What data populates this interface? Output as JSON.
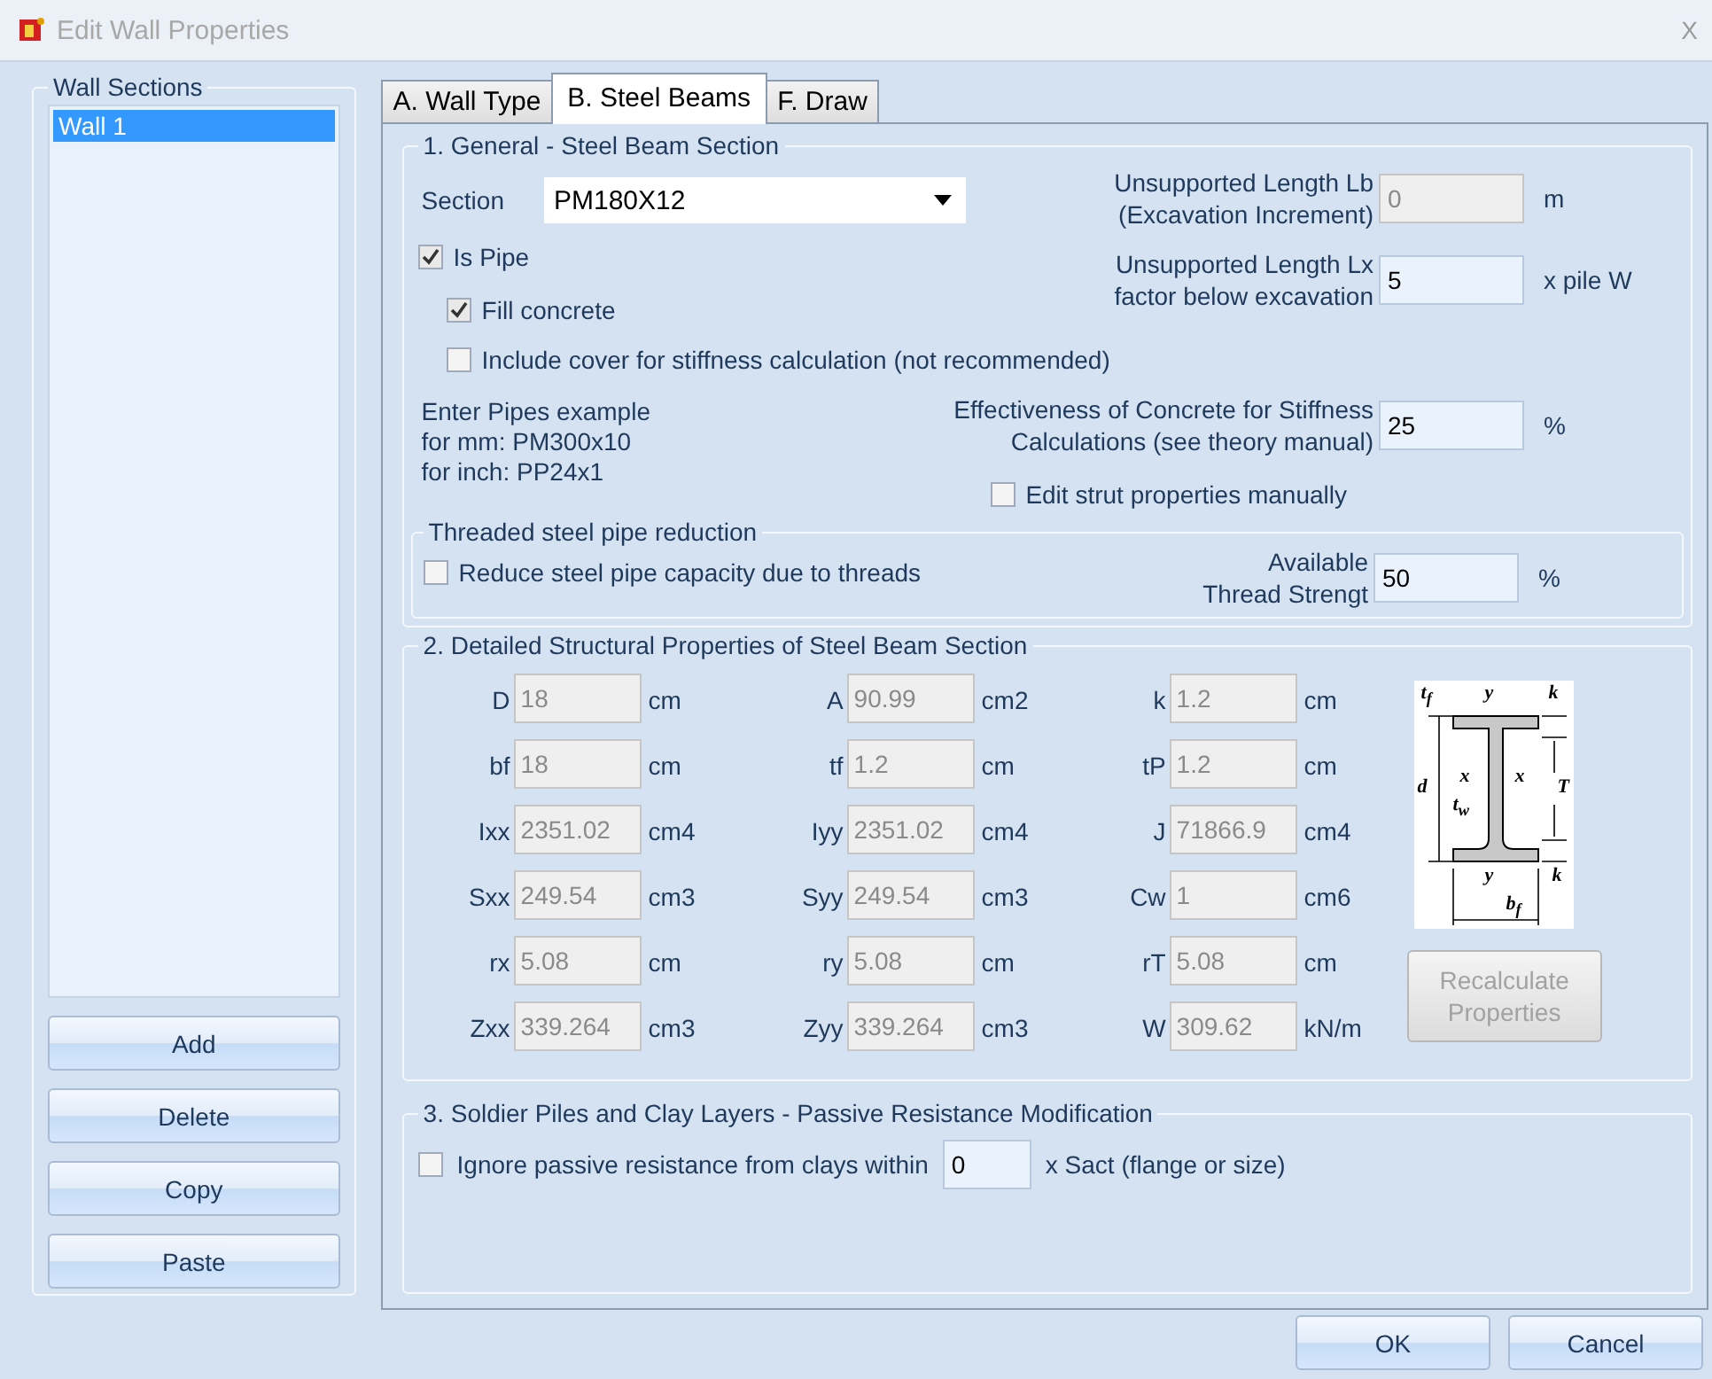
{
  "window": {
    "title": "Edit Wall Properties",
    "close": "X"
  },
  "wall_sections": {
    "title": "Wall Sections",
    "items": [
      {
        "label": "Wall 1",
        "selected": true
      }
    ],
    "buttons": [
      "Add",
      "Delete",
      "Copy",
      "Paste"
    ]
  },
  "tabs": [
    {
      "label": "A. Wall Type",
      "selected": false
    },
    {
      "label": "B. Steel Beams",
      "selected": true
    },
    {
      "label": "F. Draw",
      "selected": false
    }
  ],
  "general": {
    "title": "1. General - Steel Beam Section",
    "section_label": "Section",
    "section_value": "PM180X12",
    "checks": [
      {
        "label": "Is Pipe",
        "checked": true,
        "indent": false
      },
      {
        "label": "Fill concrete",
        "checked": true,
        "indent": true
      }
    ],
    "include_cover": {
      "label": "Include cover for stiffness calculation (not recommended)",
      "checked": false
    },
    "example": [
      "Enter Pipes example",
      "for mm: PM300x10",
      "for inch: PP24x1"
    ],
    "lengths": [
      {
        "label": [
          "Unsupported Length Lb",
          "(Excavation Increment)"
        ],
        "value": "0",
        "unit": "m",
        "disabled": true
      },
      {
        "label": [
          "Unsupported Length Lx",
          "factor below excavation"
        ],
        "value": "5",
        "unit": "x pile W",
        "disabled": false
      }
    ],
    "effectiveness": {
      "label": [
        "Effectiveness of Concrete for Stiffness",
        "Calculations (see theory manual)"
      ],
      "value": "25",
      "unit": "%",
      "disabled": false
    },
    "edit_strut": {
      "label": "Edit strut properties manually",
      "checked": false
    },
    "threaded": {
      "title": "Threaded steel pipe reduction",
      "reduce": {
        "label": "Reduce steel pipe capacity due to threads",
        "checked": false
      },
      "strength": {
        "label": [
          "Available",
          "Thread Strengt"
        ],
        "value": "50",
        "unit": "%",
        "disabled": false
      }
    }
  },
  "properties": {
    "title": "2. Detailed Structural Properties of Steel Beam Section",
    "rows": [
      [
        {
          "label": "D",
          "value": "18",
          "unit": "cm"
        },
        {
          "label": "A",
          "value": "90.99",
          "unit": "cm2"
        },
        {
          "label": "k",
          "value": "1.2",
          "unit": "cm"
        }
      ],
      [
        {
          "label": "bf",
          "value": "18",
          "unit": "cm"
        },
        {
          "label": "tf",
          "value": "1.2",
          "unit": "cm"
        },
        {
          "label": "tP",
          "value": "1.2",
          "unit": "cm"
        }
      ],
      [
        {
          "label": "Ixx",
          "value": "2351.02",
          "unit": "cm4"
        },
        {
          "label": "Iyy",
          "value": "2351.02",
          "unit": "cm4"
        },
        {
          "label": "J",
          "value": "71866.9",
          "unit": "cm4"
        }
      ],
      [
        {
          "label": "Sxx",
          "value": "249.54",
          "unit": "cm3"
        },
        {
          "label": "Syy",
          "value": "249.54",
          "unit": "cm3"
        },
        {
          "label": "Cw",
          "value": "1",
          "unit": "cm6"
        }
      ],
      [
        {
          "label": "rx",
          "value": "5.08",
          "unit": "cm"
        },
        {
          "label": "ry",
          "value": "5.08",
          "unit": "cm"
        },
        {
          "label": "rT",
          "value": "5.08",
          "unit": "cm"
        }
      ],
      [
        {
          "label": "Zxx",
          "value": "339.264",
          "unit": "cm3"
        },
        {
          "label": "Zyy",
          "value": "339.264",
          "unit": "cm3"
        },
        {
          "label": "W",
          "value": "309.62",
          "unit": "kN/m"
        }
      ]
    ],
    "diagram_labels": [
      "t$_{f}$",
      "y",
      "k",
      "d",
      "x",
      "x",
      "t$_{w}$",
      "T",
      "y",
      "k",
      "b$_{f}$"
    ],
    "recalculate": {
      "label": "Recalculate Properties",
      "disabled": true
    }
  },
  "passive": {
    "title": "3. Soldier Piles and Clay Layers - Passive Resistance Modification",
    "ignore": {
      "label": "Ignore passive resistance from clays within",
      "checked": false
    },
    "value": "0",
    "suffix": "x Sact (flange or size)"
  },
  "dialog_buttons": [
    "OK",
    "Cancel"
  ]
}
